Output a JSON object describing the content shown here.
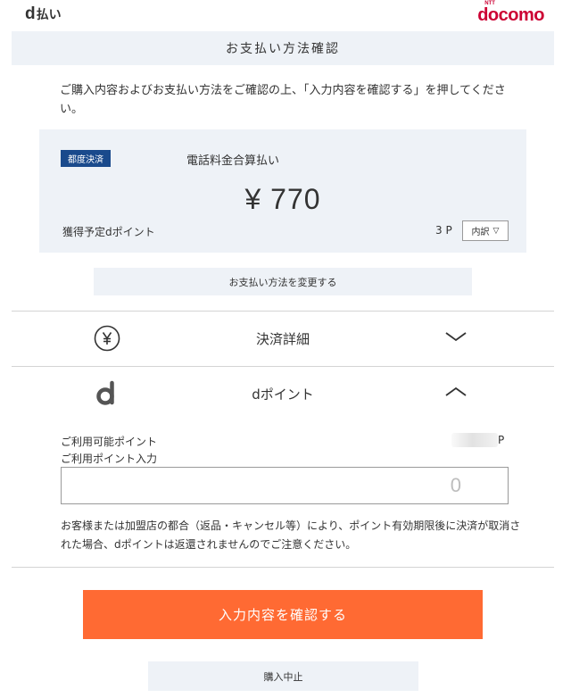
{
  "header": {
    "dpay_logo_d": "d",
    "dpay_logo_text": "払い",
    "docomo_logo": "docomo",
    "docomo_logo_ntt": "NTT"
  },
  "page_title": "お支払い方法確認",
  "intro_text": "ご購入内容およびお支払い方法をご確認の上、「入力内容を確認する」を押してください。",
  "summary": {
    "badge": "都度決済",
    "method": "電話料金合算払い",
    "amount": "¥ 770",
    "points_label": "獲得予定dポイント",
    "points_value": "3 P",
    "breakdown_label": "内訳",
    "breakdown_icon": "▽"
  },
  "change_method_label": "お支払い方法を変更する",
  "accordions": {
    "payment_detail": {
      "label": "決済詳細",
      "icon": "yen-circle-icon",
      "state": "collapsed"
    },
    "dpoint": {
      "label": "dポイント",
      "icon": "dpoint-icon",
      "state": "expanded"
    }
  },
  "dpoint_section": {
    "available_label": "ご利用可能ポイント",
    "available_unit": "P",
    "use_label": "ご利用ポイント入力",
    "input_value": "0",
    "notice": "お客様または加盟店の都合（返品・キャンセル等）により、ポイント有効期限後に決済が取消された場合、dポイントは返還されませんのでご注意ください。"
  },
  "buttons": {
    "confirm": "入力内容を確認する",
    "cancel": "購入中止"
  },
  "colors": {
    "accent_orange": "#ff6a33",
    "badge_blue": "#1a4a8c",
    "panel_bg": "#eef2f7",
    "docomo_red": "#cc0033"
  }
}
